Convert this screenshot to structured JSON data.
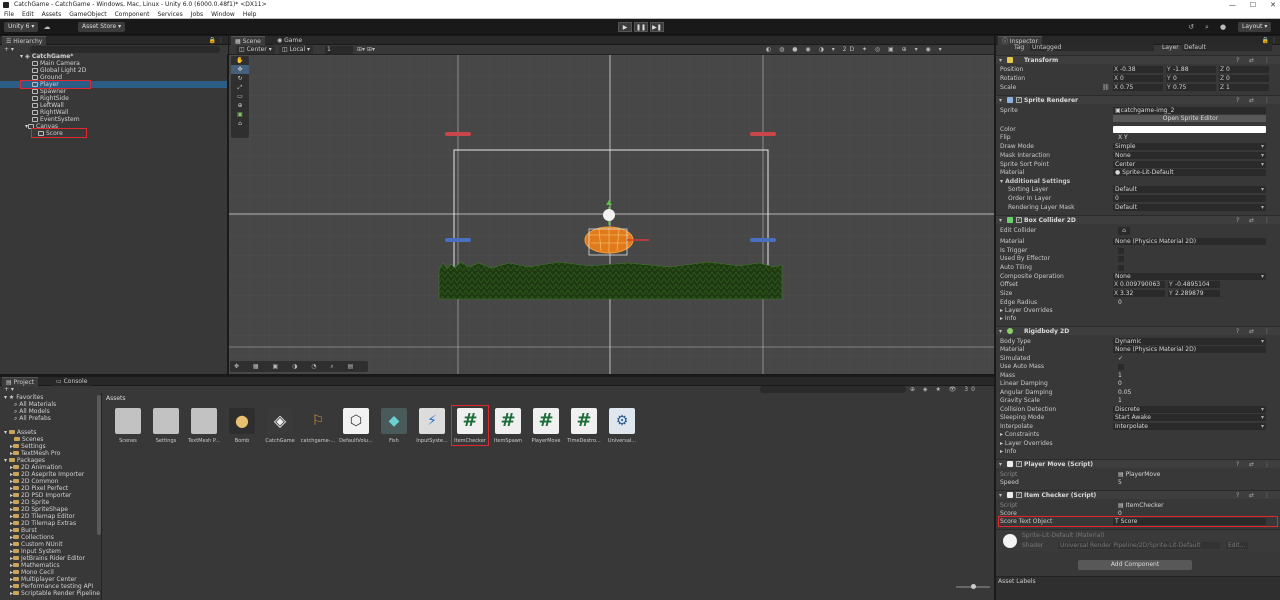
{
  "window": {
    "title": "CatchGame - CatchGame - Windows, Mac, Linux - Unity 6.0 (6000.0.48f1)* <DX11>"
  },
  "menu": [
    "File",
    "Edit",
    "Assets",
    "GameObject",
    "Component",
    "Services",
    "Jobs",
    "Window",
    "Help"
  ],
  "toolbar": {
    "account": "Unity 6",
    "asset_store": "Asset Store",
    "layout": "Layout"
  },
  "hierarchy": {
    "tab": "Hierarchy",
    "scene": "CatchGame*",
    "items": [
      "Main Camera",
      "Global Light 2D",
      "Ground",
      "Player",
      "Spawner",
      "RightSide",
      "LeftWall",
      "RightWall",
      "EventSystem",
      "Canvas",
      "Score"
    ]
  },
  "scene": {
    "tab_scene": "Scene",
    "tab_game": "Game",
    "pivot": "Center",
    "space": "Local",
    "snap": "1"
  },
  "project": {
    "tab_project": "Project",
    "tab_console": "Console",
    "breadcrumb": "Assets",
    "count": "30",
    "tree": {
      "favorites": "Favorites",
      "fav_items": [
        "All Materials",
        "All Models",
        "All Prefabs"
      ],
      "assets": "Assets",
      "asset_items": [
        "Scenes",
        "Settings",
        "TextMesh Pro"
      ],
      "packages": "Packages",
      "package_items": [
        "2D Animation",
        "2D Aseprite Importer",
        "2D Common",
        "2D Pixel Perfect",
        "2D PSD Importer",
        "2D Sprite",
        "2D SpriteShape",
        "2D Tilemap Editor",
        "2D Tilemap Extras",
        "Burst",
        "Collections",
        "Custom NUnit",
        "Input System",
        "JetBrains Rider Editor",
        "Mathematics",
        "Mono Cecil",
        "Multiplayer Center",
        "Performance testing API",
        "Scriptable Render Pipeline"
      ]
    },
    "assets": [
      {
        "label": "Scenes",
        "kind": "folder"
      },
      {
        "label": "Settings",
        "kind": "folder"
      },
      {
        "label": "TextMesh P...",
        "kind": "folder"
      },
      {
        "label": "Bomb",
        "kind": "sprite"
      },
      {
        "label": "CatchGame",
        "kind": "unity"
      },
      {
        "label": "catchgame-...",
        "kind": "sprite"
      },
      {
        "label": "DefaultVolu...",
        "kind": "cube"
      },
      {
        "label": "Fish",
        "kind": "sprite"
      },
      {
        "label": "InputSyste...",
        "kind": "input"
      },
      {
        "label": "ItemChecker",
        "kind": "script"
      },
      {
        "label": "ItemSpawn",
        "kind": "script"
      },
      {
        "label": "PlayerMove",
        "kind": "script"
      },
      {
        "label": "TimeDestro...",
        "kind": "script"
      },
      {
        "label": "Universal...",
        "kind": "urp"
      }
    ]
  },
  "inspector": {
    "tab": "Inspector",
    "tag_label": "Tag",
    "tag": "Untagged",
    "layer_label": "Layer",
    "layer": "Default",
    "transform": {
      "title": "Transform",
      "pos_label": "Position",
      "rot_label": "Rotation",
      "scale_label": "Scale",
      "pos": [
        "-0.38",
        "-1.88",
        "0"
      ],
      "rot": [
        "0",
        "0",
        "0"
      ],
      "scale": [
        "0.75",
        "0.75",
        "1"
      ]
    },
    "sprite_renderer": {
      "title": "Sprite Renderer",
      "rows": [
        {
          "label": "Sprite",
          "value": "catchgame-img_2"
        },
        {
          "label": "",
          "value": "Open Sprite Editor"
        },
        {
          "label": "Color",
          "value": ""
        },
        {
          "label": "Flip",
          "value": "X   Y"
        },
        {
          "label": "Draw Mode",
          "value": "Simple"
        },
        {
          "label": "Mask Interaction",
          "value": "None"
        },
        {
          "label": "Sprite Sort Point",
          "value": "Center"
        },
        {
          "label": "Material",
          "value": "Sprite-Lit-Default"
        },
        {
          "label": "Additional Settings",
          "value": ""
        },
        {
          "label": "Sorting Layer",
          "value": "Default"
        },
        {
          "label": "Order In Layer",
          "value": "0"
        },
        {
          "label": "Rendering Layer Mask",
          "value": "Default"
        }
      ]
    },
    "box_collider": {
      "title": "Box Collider 2D",
      "rows": [
        {
          "label": "Edit Collider",
          "value": ""
        },
        {
          "label": "Material",
          "value": "None (Physics Material 2D)"
        },
        {
          "label": "Is Trigger",
          "value": ""
        },
        {
          "label": "Used By Effector",
          "value": ""
        },
        {
          "label": "Auto Tiling",
          "value": ""
        },
        {
          "label": "Composite Operation",
          "value": "None"
        }
      ],
      "offset_label": "Offset",
      "offset": [
        "0.009790063",
        "-0.4895104"
      ],
      "size_label": "Size",
      "size": [
        "3.32",
        "2.289879"
      ],
      "rows2": [
        {
          "label": "Edge Radius",
          "value": "0"
        },
        {
          "label": "Layer Overrides",
          "value": ""
        },
        {
          "label": "Info",
          "value": ""
        }
      ]
    },
    "rigidbody": {
      "title": "Rigidbody 2D",
      "rows": [
        {
          "label": "Body Type",
          "value": "Dynamic"
        },
        {
          "label": "Material",
          "value": "None (Physics Material 2D)"
        },
        {
          "label": "Simulated",
          "value": "✓"
        },
        {
          "label": "Use Auto Mass",
          "value": ""
        },
        {
          "label": "Mass",
          "value": "1"
        },
        {
          "label": "Linear Damping",
          "value": "0"
        },
        {
          "label": "Angular Damping",
          "value": "0.05"
        },
        {
          "label": "Gravity Scale",
          "value": "1"
        },
        {
          "label": "Collision Detection",
          "value": "Discrete"
        },
        {
          "label": "Sleeping Mode",
          "value": "Start Awake"
        },
        {
          "label": "Interpolate",
          "value": "Interpolate"
        },
        {
          "label": "Constraints",
          "value": ""
        },
        {
          "label": "Layer Overrides",
          "value": ""
        },
        {
          "label": "Info",
          "value": ""
        }
      ]
    },
    "player_move": {
      "title": "Player Move (Script)",
      "script_label": "Script",
      "script": "PlayerMove",
      "speed_label": "Speed",
      "speed": "5"
    },
    "item_checker": {
      "title": "Item Checker (Script)",
      "script_label": "Script",
      "script": "ItemChecker",
      "score_label": "Score",
      "score": "0",
      "sto_label": "Score Text Object",
      "sto": "Score"
    },
    "material": {
      "name": "Sprite-Lit-Default (Material)",
      "shader_label": "Shader",
      "shader": "Universal Render Pipeline/2D/Sprite-Lit-Default",
      "edit": "Edit..."
    },
    "add_component": "Add Component",
    "asset_labels": "Asset Labels"
  }
}
